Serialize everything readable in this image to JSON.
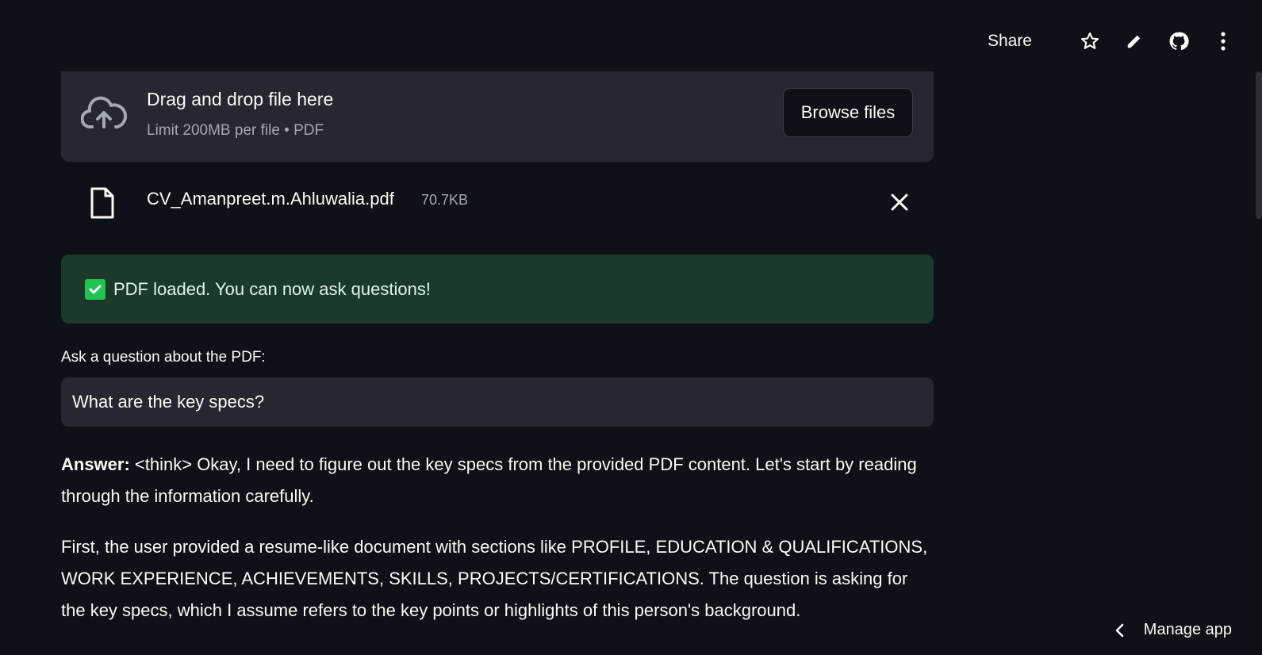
{
  "header": {
    "share_label": "Share",
    "icons": [
      "star-icon",
      "pencil-icon",
      "github-icon",
      "more-vertical-icon"
    ]
  },
  "uploader": {
    "drag_text": "Drag and drop file here",
    "limit_text": "Limit 200MB per file • PDF",
    "browse_label": "Browse files"
  },
  "uploaded_file": {
    "name": "CV_Amanpreet.m.Ahluwalia.pdf",
    "size": "70.7KB"
  },
  "alert": {
    "text": "PDF loaded. You can now ask questions!",
    "color": "#21c354"
  },
  "question": {
    "label": "Ask a question about the PDF:",
    "value": "What are the key specs?"
  },
  "answer": {
    "label": "Answer:",
    "paragraph1": " <think> Okay, I need to figure out the key specs from the provided PDF content. Let's start by reading through the information carefully.",
    "paragraph2": "First, the user provided a resume-like document with sections like PROFILE, EDUCATION & QUALIFICATIONS, WORK EXPERIENCE, ACHIEVEMENTS, SKILLS, PROJECTS/CERTIFICATIONS. The question is asking for the key specs, which I assume refers to the key points or highlights of this person's background."
  },
  "footer": {
    "manage_label": "Manage app"
  }
}
